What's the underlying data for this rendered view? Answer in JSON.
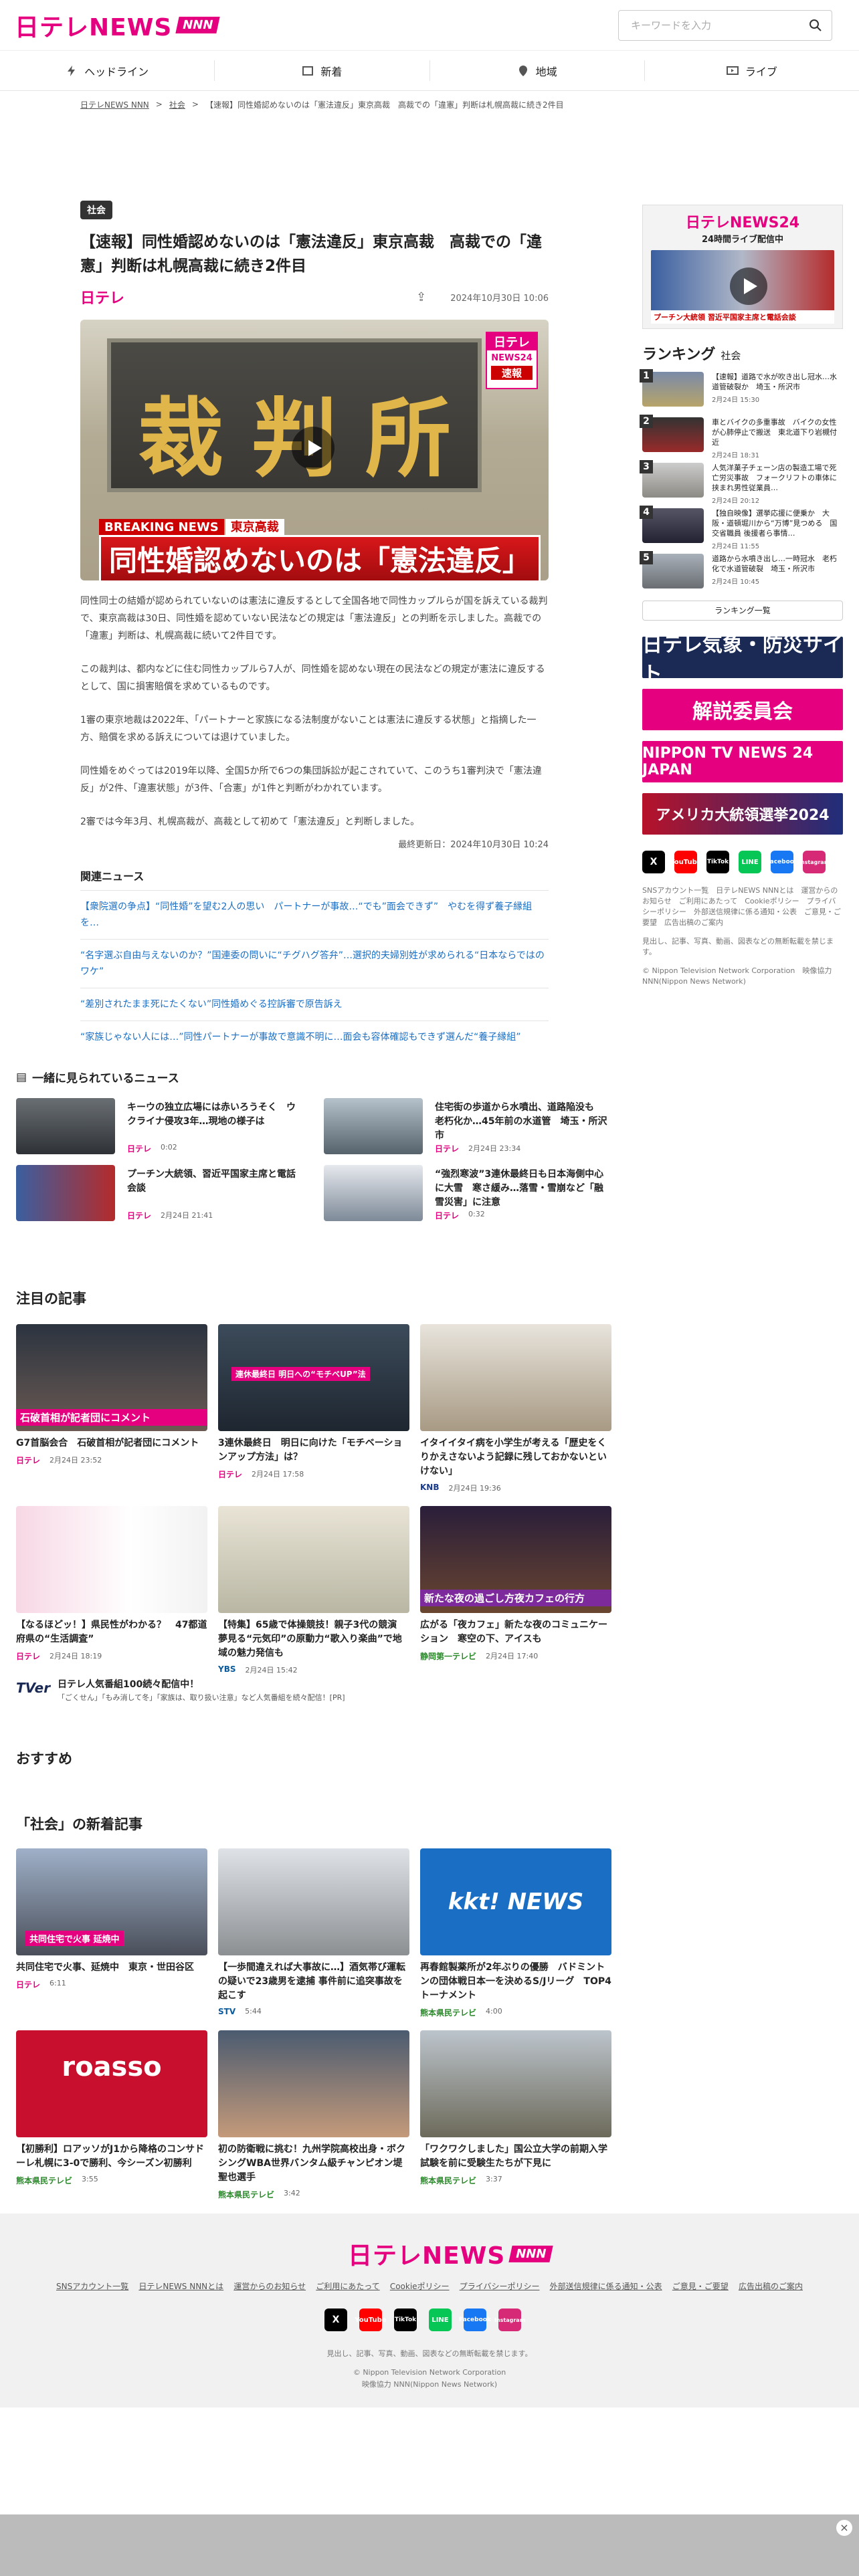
{
  "header": {
    "logo": "日テレNEWS",
    "logo_badge": "NNN",
    "search_placeholder": "キーワードを入力"
  },
  "nav": [
    "ヘッドライン",
    "新着",
    "地域",
    "ライブ"
  ],
  "breadcrumb": [
    "日テレNEWS NNN",
    "社会",
    "【速報】同性婚認めないのは「憲法違反」東京高裁　高裁での「違憲」判断は札幌高裁に続き2件目"
  ],
  "article": {
    "category": "社会",
    "title": "【速報】同性婚認めないのは「憲法違反」東京高裁　高裁での「違憲」判断は札幌高裁に続き2件目",
    "source": "日テレ",
    "date": "2024年10月30日 10:06",
    "hero_plate": [
      "裁",
      "判",
      "所"
    ],
    "hero_badge": [
      "日テレ",
      "NEWS24",
      "速報"
    ],
    "hero_break": "BREAKING NEWS",
    "hero_place": "東京高裁",
    "hero_caption": "同性婚認めないのは「憲法違反」",
    "paragraphs": [
      "同性同士の結婚が認められていないのは憲法に違反するとして全国各地で同性カップルらが国を訴えている裁判で、東京高裁は30日、同性婚を認めていない民法などの規定は「憲法違反」との判断を示しました。高裁での「違憲」判断は、札幌高裁に続いて2件目です。",
      "この裁判は、都内などに住む同性カップルら7人が、同性婚を認めない現在の民法などの規定が憲法に違反するとして、国に損害賠償を求めているものです。",
      "1審の東京地裁は2022年、「パートナーと家族になる法制度がないことは憲法に違反する状態」と指摘した一方、賠償を求める訴えについては退けていました。",
      "同性婚をめぐっては2019年以降、全国5か所で6つの集団訴訟が起こされていて、このうち1審判決で「憲法違反」が2件、「違憲状態」が3件、「合憲」が1件と判断がわかれています。",
      "2審では今年3月、札幌高裁が、高裁として初めて「憲法違反」と判断しました。"
    ],
    "updated": "最終更新日：2024年10月30日 10:24"
  },
  "related": {
    "heading": "関連ニュース",
    "items": [
      "【衆院選の争点】“同性婚”を望む2人の思い　パートナーが事故…“でも”面会できず”　やむを得ず養子縁組を…",
      "“名字選ぶ自由与えないのか？”国連委の問いに“チグハグ答弁”…選択的夫婦別姓が求められる“日本ならではのワケ”",
      "“差別されたまま死にたくない”同性婚めぐる控訴審で原告訴え",
      "“家族じゃない人には…”同性パートナーが事故で意識不明に…面会も容体確認もできず選んだ“養子縁組”"
    ]
  },
  "together": {
    "heading": "一緒に見られているニュース",
    "items": [
      {
        "title": "キーウの独立広場には赤いろうそく　ウクライナ侵攻3年…現地の様子は",
        "src": "日テレ",
        "time": "0:02"
      },
      {
        "title": "住宅街の歩道から水噴出、道路陥没も　老朽化か…45年前の水道管　埼玉・所沢市",
        "src": "日テレ",
        "time": "2月24日 23:34"
      },
      {
        "title": "プーチン大統領、習近平国家主席と電話会談",
        "src": "日テレ",
        "time": "2月24日 21:41"
      },
      {
        "title": "“強烈寒波”3連休最終日も日本海側中心に大雪　寒さ緩み…落雪・雪崩など「融雪災害」に注意",
        "src": "日テレ",
        "time": "0:32"
      }
    ]
  },
  "featured": {
    "heading": "注目の記事",
    "items": [
      {
        "title": "G7首脳会合　石破首相が記者団にコメント",
        "src": "日テレ",
        "time": "2月24日 23:52",
        "cap": "石破首相が記者団にコメント"
      },
      {
        "title": "3連休最終日　明日に向けた「モチベーションアップ方法」は？",
        "src": "日テレ",
        "time": "2月24日 17:58",
        "cap": "連休最終日 明日への“モチベUP”法"
      },
      {
        "title": "イタイイタイ病を小学生が考える「歴史をくりかえさないよう記録に残しておかないといけない」",
        "src": "KNB",
        "time": "2月24日 19:36",
        "cap": ""
      },
      {
        "title": "【なるほどッ！】県民性がわかる？　47都道府県の“生活調査”",
        "src": "日テレ",
        "time": "2月24日 18:19",
        "cap": ""
      },
      {
        "title": "【特集】65歳で体操競技！親子3代の競演　夢見る“元気印”の原動力“歌入り楽曲”で地域の魅力発信も",
        "src": "YBS",
        "time": "2月24日 15:42",
        "cap": ""
      },
      {
        "title": "広がる「夜カフェ」新たな夜のコミュニケーション　寒空の下、アイスも",
        "src": "静岡第一テレビ",
        "time": "2月24日 17:40",
        "cap": "新たな夜の過ごし方夜カフェの行方"
      }
    ]
  },
  "promo": {
    "logo": "TVer",
    "title": "日テレ人気番組100続々配信中！",
    "sub": "「ごくせん」「もみ消して冬」「家族は、取り扱い注意」など人気番組を続々配信！[PR]"
  },
  "recommend": {
    "heading": "おすすめ"
  },
  "latest": {
    "heading": "「社会」の新着記事",
    "items": [
      {
        "title": "共同住宅で火事、延焼中　東京・世田谷区",
        "src": "日テレ",
        "time": "6:11",
        "cap": "共同住宅で火事 延焼中"
      },
      {
        "title": "【一歩間違えれば大事故に…】酒気帯び運転の疑いで23歳男を逮捕 事件前に追突事故を起こす",
        "src": "STV",
        "time": "5:44",
        "cap": ""
      },
      {
        "title": "再春館製薬所が2年ぶりの優勝　バドミントンの団体戦日本一を決めるS/Jリーグ　TOP4トーナメント",
        "src": "熊本県民テレビ",
        "time": "4:00",
        "cap": "kkt! NEWS"
      },
      {
        "title": "【初勝利】ロアッソがJ1から降格のコンサドーレ札幌に3-0で勝利、今シーズン初勝利",
        "src": "熊本県民テレビ",
        "time": "3:55",
        "cap": "roasso"
      },
      {
        "title": "初の防衛戦に挑む！九州学院高校出身・ボクシングWBA世界バンタム級チャンピオン堤聖也選手",
        "src": "熊本県民テレビ",
        "time": "3:42",
        "cap": ""
      },
      {
        "title": "「ワクワクしました」国公立大学の前期入学試験を前に受験生たちが下見に",
        "src": "熊本県民テレビ",
        "time": "3:37",
        "cap": ""
      }
    ]
  },
  "sidebar": {
    "n24_logo": "日テレNEWS24",
    "n24_sub": "24時間ライブ配信中",
    "n24_cap": "プーチン大統領 習近平国家主席と電話会談",
    "ranking_heading": "ランキング",
    "ranking_cat": "社会",
    "ranking": [
      {
        "title": "【速報】道路で水が吹き出し冠水…水道管破裂か　埼玉・所沢市",
        "time": "2月24日 15:30"
      },
      {
        "title": "車とバイクの多重事故　バイクの女性が心肺停止で搬送　東北道下り岩槻付近",
        "time": "2月24日 18:31"
      },
      {
        "title": "人気洋菓子チェーン店の製造工場で死亡労災事故　フォークリフトの車体に挟まれ男性従業員…",
        "time": "2月24日 20:12"
      },
      {
        "title": "【独自映像】選挙応援に便乗か　大阪・道頓堀川から“万博”見つめる　国交省職員 後援者ら事情…",
        "time": "2月24日 11:55"
      },
      {
        "title": "道路から水噴き出し…一時冠水　老朽化で水道管破裂　埼玉・所沢市",
        "time": "2月24日 10:45"
      }
    ],
    "ranking_more": "ランキング一覧",
    "banners": [
      "日テレ気象・防災サイト",
      "解説委員会",
      "NIPPON TV NEWS 24 JAPAN",
      "アメリカ大統領選挙2024"
    ],
    "links": "SNSアカウント一覧　日テレNEWS NNNとは　運営からのお知らせ　ご利用にあたって　Cookieポリシー　プライバシーポリシー　外部送信規律に係る通知・公表　ご意見・ご要望　広告出稿のご案内",
    "notice": "見出し、記事、写真、動画、図表などの無断転載を禁じます。",
    "copy": "© Nippon Television Network Corporation　映像協力 NNN(Nippon News Network)"
  },
  "footer": {
    "links": [
      "SNSアカウント一覧",
      "日テレNEWS NNNとは",
      "運営からのお知らせ",
      "ご利用にあたって",
      "Cookieポリシー",
      "プライバシーポリシー",
      "外部送信規律に係る通知・公表",
      "ご意見・ご要望",
      "広告出稿のご案内"
    ],
    "notice": "見出し、記事、写真、動画、図表などの無断転載を禁じます。",
    "copy": "© Nippon Television Network Corporation",
    "copy2": "映像協力 NNN(Nippon News Network)"
  },
  "social": [
    "X",
    "YouTube",
    "TikTok",
    "LINE",
    "Facebook",
    "Instagram"
  ],
  "colors": {
    "brand": "#e4007f",
    "link": "#1a6fc4"
  }
}
